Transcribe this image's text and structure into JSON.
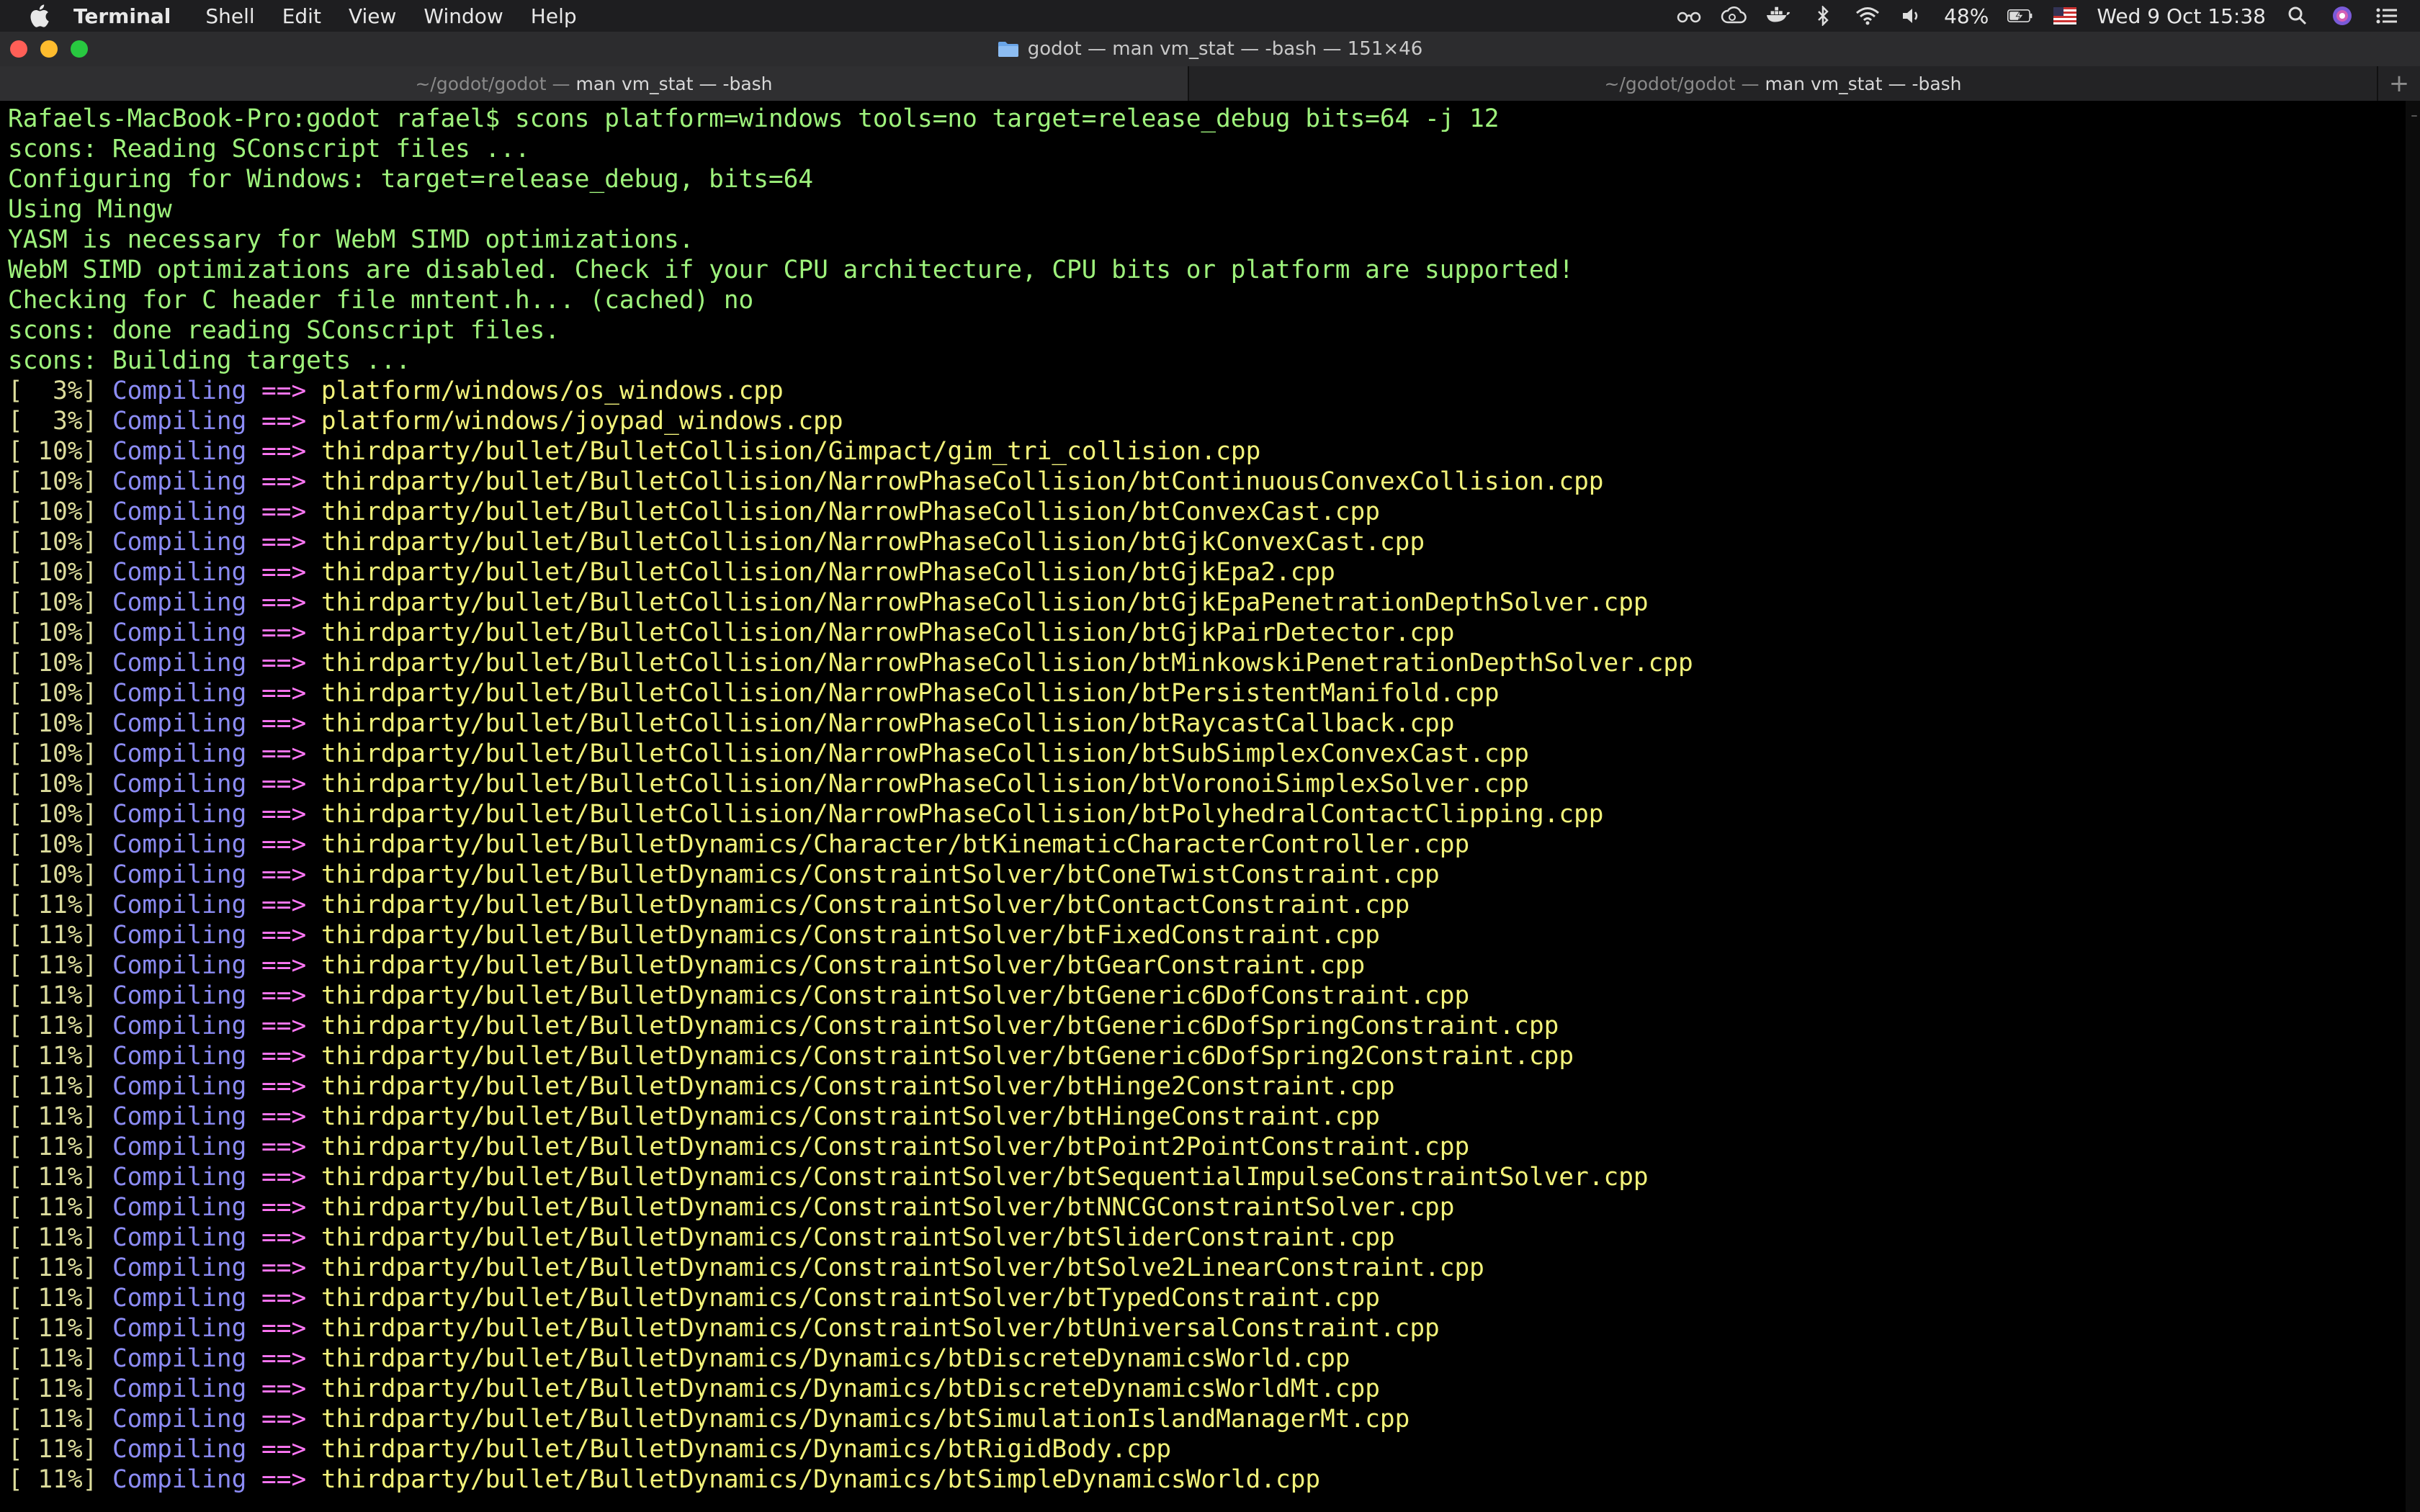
{
  "menubar": {
    "app_name": "Terminal",
    "items": [
      "Shell",
      "Edit",
      "View",
      "Window",
      "Help"
    ],
    "battery": "48%",
    "datetime": "Wed 9 Oct  15:38"
  },
  "window": {
    "title": "godot — man vm_stat — -bash — 151×46",
    "tabs": [
      {
        "path": "~/godot/godot —",
        "command": "man vm_stat — -bash",
        "active": true
      },
      {
        "path": "~/godot/godot —",
        "command": "man vm_stat — -bash",
        "active": false
      }
    ]
  },
  "terminal": {
    "header_lines": [
      "Rafaels-MacBook-Pro:godot rafael$ scons platform=windows tools=no target=release_debug bits=64 -j 12",
      "scons: Reading SConscript files ...",
      "Configuring for Windows: target=release_debug, bits=64",
      "Using Mingw",
      "YASM is necessary for WebM SIMD optimizations.",
      "WebM SIMD optimizations are disabled. Check if your CPU architecture, CPU bits or platform are supported!",
      "Checking for C header file mntent.h... (cached) no",
      "scons: done reading SConscript files.",
      "scons: Building targets ..."
    ],
    "compile_label": "Compiling",
    "arrow": "==>",
    "compile_lines": [
      {
        "pct": "[  3%]",
        "file": "platform/windows/os_windows.cpp"
      },
      {
        "pct": "[  3%]",
        "file": "platform/windows/joypad_windows.cpp"
      },
      {
        "pct": "[ 10%]",
        "file": "thirdparty/bullet/BulletCollision/Gimpact/gim_tri_collision.cpp"
      },
      {
        "pct": "[ 10%]",
        "file": "thirdparty/bullet/BulletCollision/NarrowPhaseCollision/btContinuousConvexCollision.cpp"
      },
      {
        "pct": "[ 10%]",
        "file": "thirdparty/bullet/BulletCollision/NarrowPhaseCollision/btConvexCast.cpp"
      },
      {
        "pct": "[ 10%]",
        "file": "thirdparty/bullet/BulletCollision/NarrowPhaseCollision/btGjkConvexCast.cpp"
      },
      {
        "pct": "[ 10%]",
        "file": "thirdparty/bullet/BulletCollision/NarrowPhaseCollision/btGjkEpa2.cpp"
      },
      {
        "pct": "[ 10%]",
        "file": "thirdparty/bullet/BulletCollision/NarrowPhaseCollision/btGjkEpaPenetrationDepthSolver.cpp"
      },
      {
        "pct": "[ 10%]",
        "file": "thirdparty/bullet/BulletCollision/NarrowPhaseCollision/btGjkPairDetector.cpp"
      },
      {
        "pct": "[ 10%]",
        "file": "thirdparty/bullet/BulletCollision/NarrowPhaseCollision/btMinkowskiPenetrationDepthSolver.cpp"
      },
      {
        "pct": "[ 10%]",
        "file": "thirdparty/bullet/BulletCollision/NarrowPhaseCollision/btPersistentManifold.cpp"
      },
      {
        "pct": "[ 10%]",
        "file": "thirdparty/bullet/BulletCollision/NarrowPhaseCollision/btRaycastCallback.cpp"
      },
      {
        "pct": "[ 10%]",
        "file": "thirdparty/bullet/BulletCollision/NarrowPhaseCollision/btSubSimplexConvexCast.cpp"
      },
      {
        "pct": "[ 10%]",
        "file": "thirdparty/bullet/BulletCollision/NarrowPhaseCollision/btVoronoiSimplexSolver.cpp"
      },
      {
        "pct": "[ 10%]",
        "file": "thirdparty/bullet/BulletCollision/NarrowPhaseCollision/btPolyhedralContactClipping.cpp"
      },
      {
        "pct": "[ 10%]",
        "file": "thirdparty/bullet/BulletDynamics/Character/btKinematicCharacterController.cpp"
      },
      {
        "pct": "[ 10%]",
        "file": "thirdparty/bullet/BulletDynamics/ConstraintSolver/btConeTwistConstraint.cpp"
      },
      {
        "pct": "[ 11%]",
        "file": "thirdparty/bullet/BulletDynamics/ConstraintSolver/btContactConstraint.cpp"
      },
      {
        "pct": "[ 11%]",
        "file": "thirdparty/bullet/BulletDynamics/ConstraintSolver/btFixedConstraint.cpp"
      },
      {
        "pct": "[ 11%]",
        "file": "thirdparty/bullet/BulletDynamics/ConstraintSolver/btGearConstraint.cpp"
      },
      {
        "pct": "[ 11%]",
        "file": "thirdparty/bullet/BulletDynamics/ConstraintSolver/btGeneric6DofConstraint.cpp"
      },
      {
        "pct": "[ 11%]",
        "file": "thirdparty/bullet/BulletDynamics/ConstraintSolver/btGeneric6DofSpringConstraint.cpp"
      },
      {
        "pct": "[ 11%]",
        "file": "thirdparty/bullet/BulletDynamics/ConstraintSolver/btGeneric6DofSpring2Constraint.cpp"
      },
      {
        "pct": "[ 11%]",
        "file": "thirdparty/bullet/BulletDynamics/ConstraintSolver/btHinge2Constraint.cpp"
      },
      {
        "pct": "[ 11%]",
        "file": "thirdparty/bullet/BulletDynamics/ConstraintSolver/btHingeConstraint.cpp"
      },
      {
        "pct": "[ 11%]",
        "file": "thirdparty/bullet/BulletDynamics/ConstraintSolver/btPoint2PointConstraint.cpp"
      },
      {
        "pct": "[ 11%]",
        "file": "thirdparty/bullet/BulletDynamics/ConstraintSolver/btSequentialImpulseConstraintSolver.cpp"
      },
      {
        "pct": "[ 11%]",
        "file": "thirdparty/bullet/BulletDynamics/ConstraintSolver/btNNCGConstraintSolver.cpp"
      },
      {
        "pct": "[ 11%]",
        "file": "thirdparty/bullet/BulletDynamics/ConstraintSolver/btSliderConstraint.cpp"
      },
      {
        "pct": "[ 11%]",
        "file": "thirdparty/bullet/BulletDynamics/ConstraintSolver/btSolve2LinearConstraint.cpp"
      },
      {
        "pct": "[ 11%]",
        "file": "thirdparty/bullet/BulletDynamics/ConstraintSolver/btTypedConstraint.cpp"
      },
      {
        "pct": "[ 11%]",
        "file": "thirdparty/bullet/BulletDynamics/ConstraintSolver/btUniversalConstraint.cpp"
      },
      {
        "pct": "[ 11%]",
        "file": "thirdparty/bullet/BulletDynamics/Dynamics/btDiscreteDynamicsWorld.cpp"
      },
      {
        "pct": "[ 11%]",
        "file": "thirdparty/bullet/BulletDynamics/Dynamics/btDiscreteDynamicsWorldMt.cpp"
      },
      {
        "pct": "[ 11%]",
        "file": "thirdparty/bullet/BulletDynamics/Dynamics/btSimulationIslandManagerMt.cpp"
      },
      {
        "pct": "[ 11%]",
        "file": "thirdparty/bullet/BulletDynamics/Dynamics/btRigidBody.cpp"
      },
      {
        "pct": "[ 11%]",
        "file": "thirdparty/bullet/BulletDynamics/Dynamics/btSimpleDynamicsWorld.cpp"
      }
    ]
  },
  "icons": {
    "apple": "apple-icon",
    "glasses": "glasses-icon",
    "creative_cloud": "creative-cloud-icon",
    "docker": "docker-icon",
    "bluetooth": "bluetooth-icon",
    "wifi": "wifi-icon",
    "volume": "volume-icon",
    "battery": "battery-charging-icon",
    "flag": "us-flag-icon",
    "search": "search-icon",
    "siri": "siri-icon",
    "control_center": "list-icon",
    "folder": "folder-icon",
    "new_tab": "plus-icon"
  },
  "colors": {
    "prompt_text": "#9ef27c",
    "percent": "#dcdc9c",
    "compiling": "#8c8cf5",
    "arrow": "#ff77f6",
    "file": "#f2f27a"
  }
}
